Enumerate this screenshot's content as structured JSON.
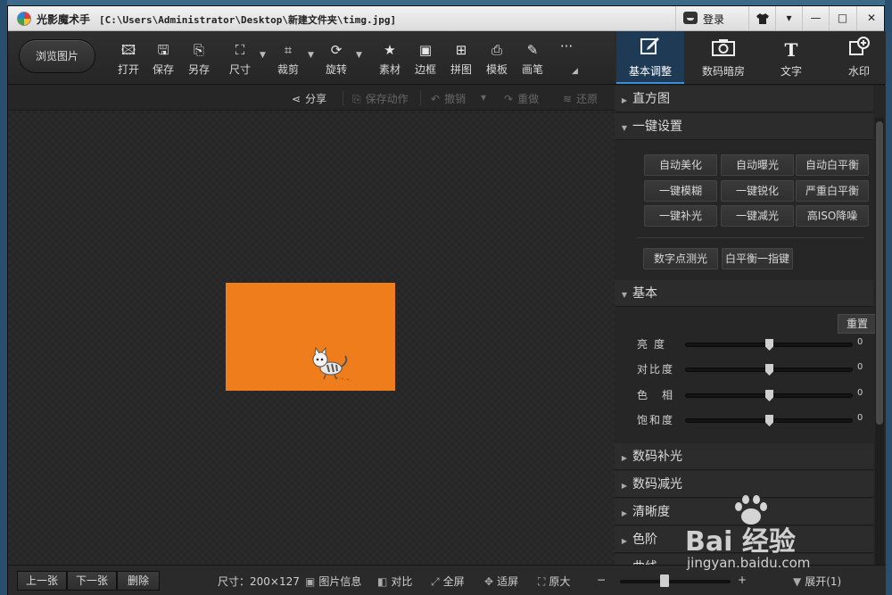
{
  "window": {
    "app_name": "光影魔术手",
    "file_path": "[C:\\Users\\Administrator\\Desktop\\新建文件夹\\timg.jpg]",
    "login_label": "登录",
    "controls": [
      "▾",
      "—",
      "□",
      "✕"
    ]
  },
  "toolbar": {
    "browse_label": "浏览图片",
    "tools": [
      {
        "icon": "open-icon",
        "label": "打开"
      },
      {
        "icon": "save-icon",
        "label": "保存"
      },
      {
        "icon": "save-as-icon",
        "label": "另存"
      },
      {
        "icon": "size-icon",
        "label": "尺寸"
      },
      {
        "icon": "crop-icon",
        "label": "裁剪"
      },
      {
        "icon": "rotate-icon",
        "label": "旋转"
      },
      {
        "icon": "material-icon",
        "label": "素材"
      },
      {
        "icon": "border-icon",
        "label": "边框"
      },
      {
        "icon": "collage-icon",
        "label": "拼图"
      },
      {
        "icon": "template-icon",
        "label": "模板"
      },
      {
        "icon": "brush-icon",
        "label": "画笔"
      }
    ],
    "more_label": "···"
  },
  "right_tabs": [
    {
      "label": "基本调整",
      "active": true
    },
    {
      "label": "数码暗房",
      "active": false
    },
    {
      "label": "文字",
      "active": false
    },
    {
      "label": "水印",
      "active": false
    }
  ],
  "actions": {
    "share": "分享",
    "save_action": "保存动作",
    "undo": "撤销",
    "redo": "重做",
    "restore": "还原"
  },
  "panel": {
    "histogram": "直方图",
    "one_click": "一键设置",
    "quick_buttons": [
      "自动美化",
      "自动曝光",
      "自动白平衡",
      "一键模糊",
      "一键锐化",
      "严重白平衡",
      "一键补光",
      "一键减光",
      "高ISO降噪"
    ],
    "extra_buttons": [
      "数字点测光",
      "白平衡一指键"
    ],
    "basic": "基本",
    "reset": "重置",
    "sliders": [
      {
        "label": "亮度",
        "value": "0",
        "position": 0.5
      },
      {
        "label": "对比度",
        "value": "0",
        "position": 0.5
      },
      {
        "label": "色相",
        "value": "0",
        "position": 0.5
      },
      {
        "label": "饱和度",
        "value": "0",
        "position": 0.5
      }
    ],
    "sections": [
      "数码补光",
      "数码减光",
      "清晰度",
      "色阶",
      "曲线"
    ]
  },
  "status": {
    "prev": "上一张",
    "next": "下一张",
    "delete": "删除",
    "size": "尺寸：200×127",
    "info": "图片信息",
    "compare": "对比",
    "fullscreen": "全屏",
    "fit": "适屏",
    "original": "原大",
    "zoom_minus": "−",
    "zoom_plus": "+",
    "zoom_level": 0.4,
    "expand": "展开(1)"
  },
  "watermark": {
    "brand": "Bai 经验",
    "url": "jingyan.baidu.com"
  },
  "colors": {
    "photo_bg": "#ef7d1b",
    "accent": "#3b8fd9"
  }
}
